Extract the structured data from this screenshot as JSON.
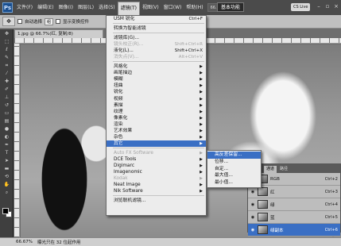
{
  "app": {
    "logo": "Ps"
  },
  "menubar": {
    "items": [
      "文件(F)",
      "编辑(E)",
      "图像(I)",
      "图层(L)",
      "选择(S)",
      "滤镜(T)",
      "视图(V)",
      "窗口(W)",
      "帮助(H)"
    ],
    "active_index": 5,
    "zoom": "66.7",
    "workspace": "基本功能",
    "live": "CS Live"
  },
  "options": {
    "auto_select": "自动选择",
    "auto_select_value": "组",
    "show_transform": "显示变换控件"
  },
  "document": {
    "tab": "1.jpg @ 66.7%(红, 复制/8)"
  },
  "filter_menu": {
    "items": [
      {
        "label": "USM 锐化",
        "shortcut": "Ctrl+F"
      },
      {
        "sep": true
      },
      {
        "label": "转换为智能滤镜"
      },
      {
        "sep": true
      },
      {
        "label": "滤镜库(G)..."
      },
      {
        "label": "镜头校正(R)...",
        "shortcut": "Shift+Ctrl+R",
        "disabled": true
      },
      {
        "label": "液化(L)...",
        "shortcut": "Shift+Ctrl+X"
      },
      {
        "label": "消失点(V)...",
        "shortcut": "Alt+Ctrl+V",
        "disabled": true
      },
      {
        "sep": true
      },
      {
        "label": "风格化",
        "submenu": true
      },
      {
        "label": "画笔描边",
        "submenu": true
      },
      {
        "label": "模糊",
        "submenu": true
      },
      {
        "label": "扭曲",
        "submenu": true
      },
      {
        "label": "锐化",
        "submenu": true
      },
      {
        "label": "视频",
        "submenu": true
      },
      {
        "label": "素描",
        "submenu": true
      },
      {
        "label": "纹理",
        "submenu": true
      },
      {
        "label": "像素化",
        "submenu": true
      },
      {
        "label": "渲染",
        "submenu": true
      },
      {
        "label": "艺术效果",
        "submenu": true
      },
      {
        "label": "杂色",
        "submenu": true
      },
      {
        "label": "其它",
        "submenu": true,
        "selected": true
      },
      {
        "sep": true
      },
      {
        "label": "Auto FX Software",
        "submenu": true,
        "disabled": true
      },
      {
        "label": "DCE Tools",
        "submenu": true
      },
      {
        "label": "Digimarc",
        "submenu": true
      },
      {
        "label": "Imagenomic",
        "submenu": true
      },
      {
        "label": "Kodak",
        "submenu": true,
        "disabled": true
      },
      {
        "label": "Neat Image",
        "submenu": true
      },
      {
        "label": "Nik Software",
        "submenu": true
      },
      {
        "sep": true
      },
      {
        "label": "浏览联机滤镜..."
      }
    ]
  },
  "submenu": {
    "items": [
      {
        "label": "高反差保留...",
        "selected": true
      },
      {
        "label": "位移..."
      },
      {
        "label": "自定..."
      },
      {
        "label": "最大值..."
      },
      {
        "label": "最小值..."
      }
    ]
  },
  "channels": {
    "tabs": [
      "图层",
      "通道",
      "路径"
    ],
    "active_tab": 1,
    "rows": [
      {
        "name": "RGB",
        "shortcut": "Ctrl+2"
      },
      {
        "name": "红",
        "shortcut": "Ctrl+3"
      },
      {
        "name": "绿",
        "shortcut": "Ctrl+4"
      },
      {
        "name": "蓝",
        "shortcut": "Ctrl+5"
      },
      {
        "name": "绿副本",
        "shortcut": "Ctrl+6",
        "active": true
      }
    ]
  },
  "status": {
    "zoom": "66.67%",
    "info": "曝光只在 32 位起作用"
  }
}
